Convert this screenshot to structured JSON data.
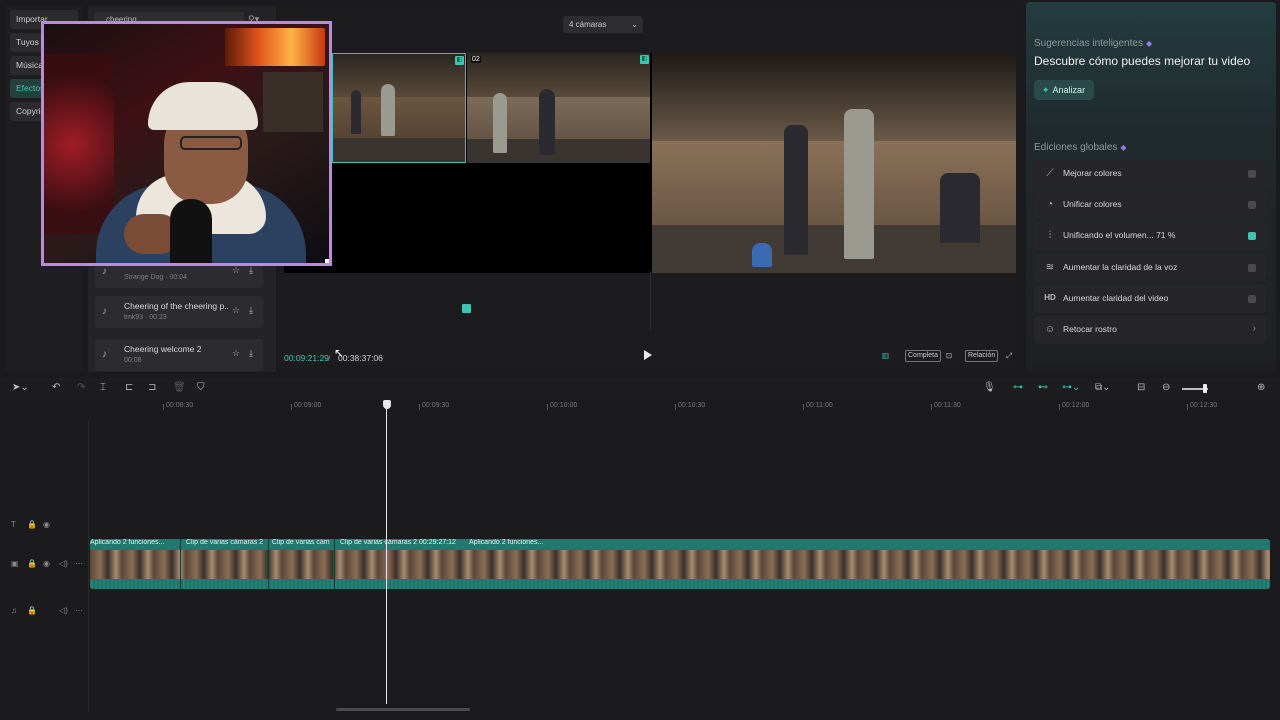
{
  "left_tabs": [
    "Importar",
    "Tuyos",
    "Música",
    "Efectos",
    "Copyrig"
  ],
  "media": {
    "search_value": "cheering",
    "filter_icon": "filter-icon",
    "sounds": [
      {
        "title": "",
        "meta": "Strange Dog · 00:04"
      },
      {
        "title": "Cheering of the cheering p...",
        "meta": "tmk93 · 00:23"
      },
      {
        "title": "Cheering welcome 2",
        "meta": "00:08"
      }
    ]
  },
  "player": {
    "camera_select": "4 cámaras",
    "cam_number": "02",
    "time_current": "00:09:21:29",
    "time_separator": "/",
    "time_total": "00:38:37:06",
    "full_label": "Completa",
    "ratio_label": "Relación"
  },
  "right": {
    "suggestions_label": "Sugerencias inteligentes",
    "suggestions_title": "Descubre cómo puedes mejorar tu video",
    "analyze_label": "Analizar",
    "global_label": "Ediciones globales",
    "edits": [
      {
        "label": "Mejorar colores",
        "icon": "wand-icon",
        "state": "off"
      },
      {
        "label": "Unificar colores",
        "icon": "color-sync-icon",
        "state": "off"
      },
      {
        "label": "Unificando el volumen... 71 %",
        "icon": "sliders-icon",
        "state": "on"
      },
      {
        "label": "Aumentar la claridad de la voz",
        "icon": "voice-wave-icon",
        "state": "off"
      },
      {
        "label": "Aumentar claridad del video",
        "icon": "hd-icon",
        "state": "off"
      },
      {
        "label": "Retocar rostro",
        "icon": "face-retouch-icon",
        "state": "arrow"
      }
    ]
  },
  "timeline": {
    "ruler": [
      "00:08:30",
      "00:09:00",
      "00:09:30",
      "00:10:00",
      "00:10:30",
      "00:11:00",
      "00:11:30",
      "00:12:00",
      "00:12:30"
    ],
    "clip_labels": [
      "Aplicando 2 funciones...",
      "Clip de varias cámaras 2",
      "Clip de varias cám",
      "Clip de varias cámaras 2  00:29:27:12",
      "Aplicando 2 funciones..."
    ]
  },
  "colors": {
    "accent": "#3fc4b4",
    "webcam_border": "#b88ae8",
    "clip": "#1f7a6e"
  }
}
